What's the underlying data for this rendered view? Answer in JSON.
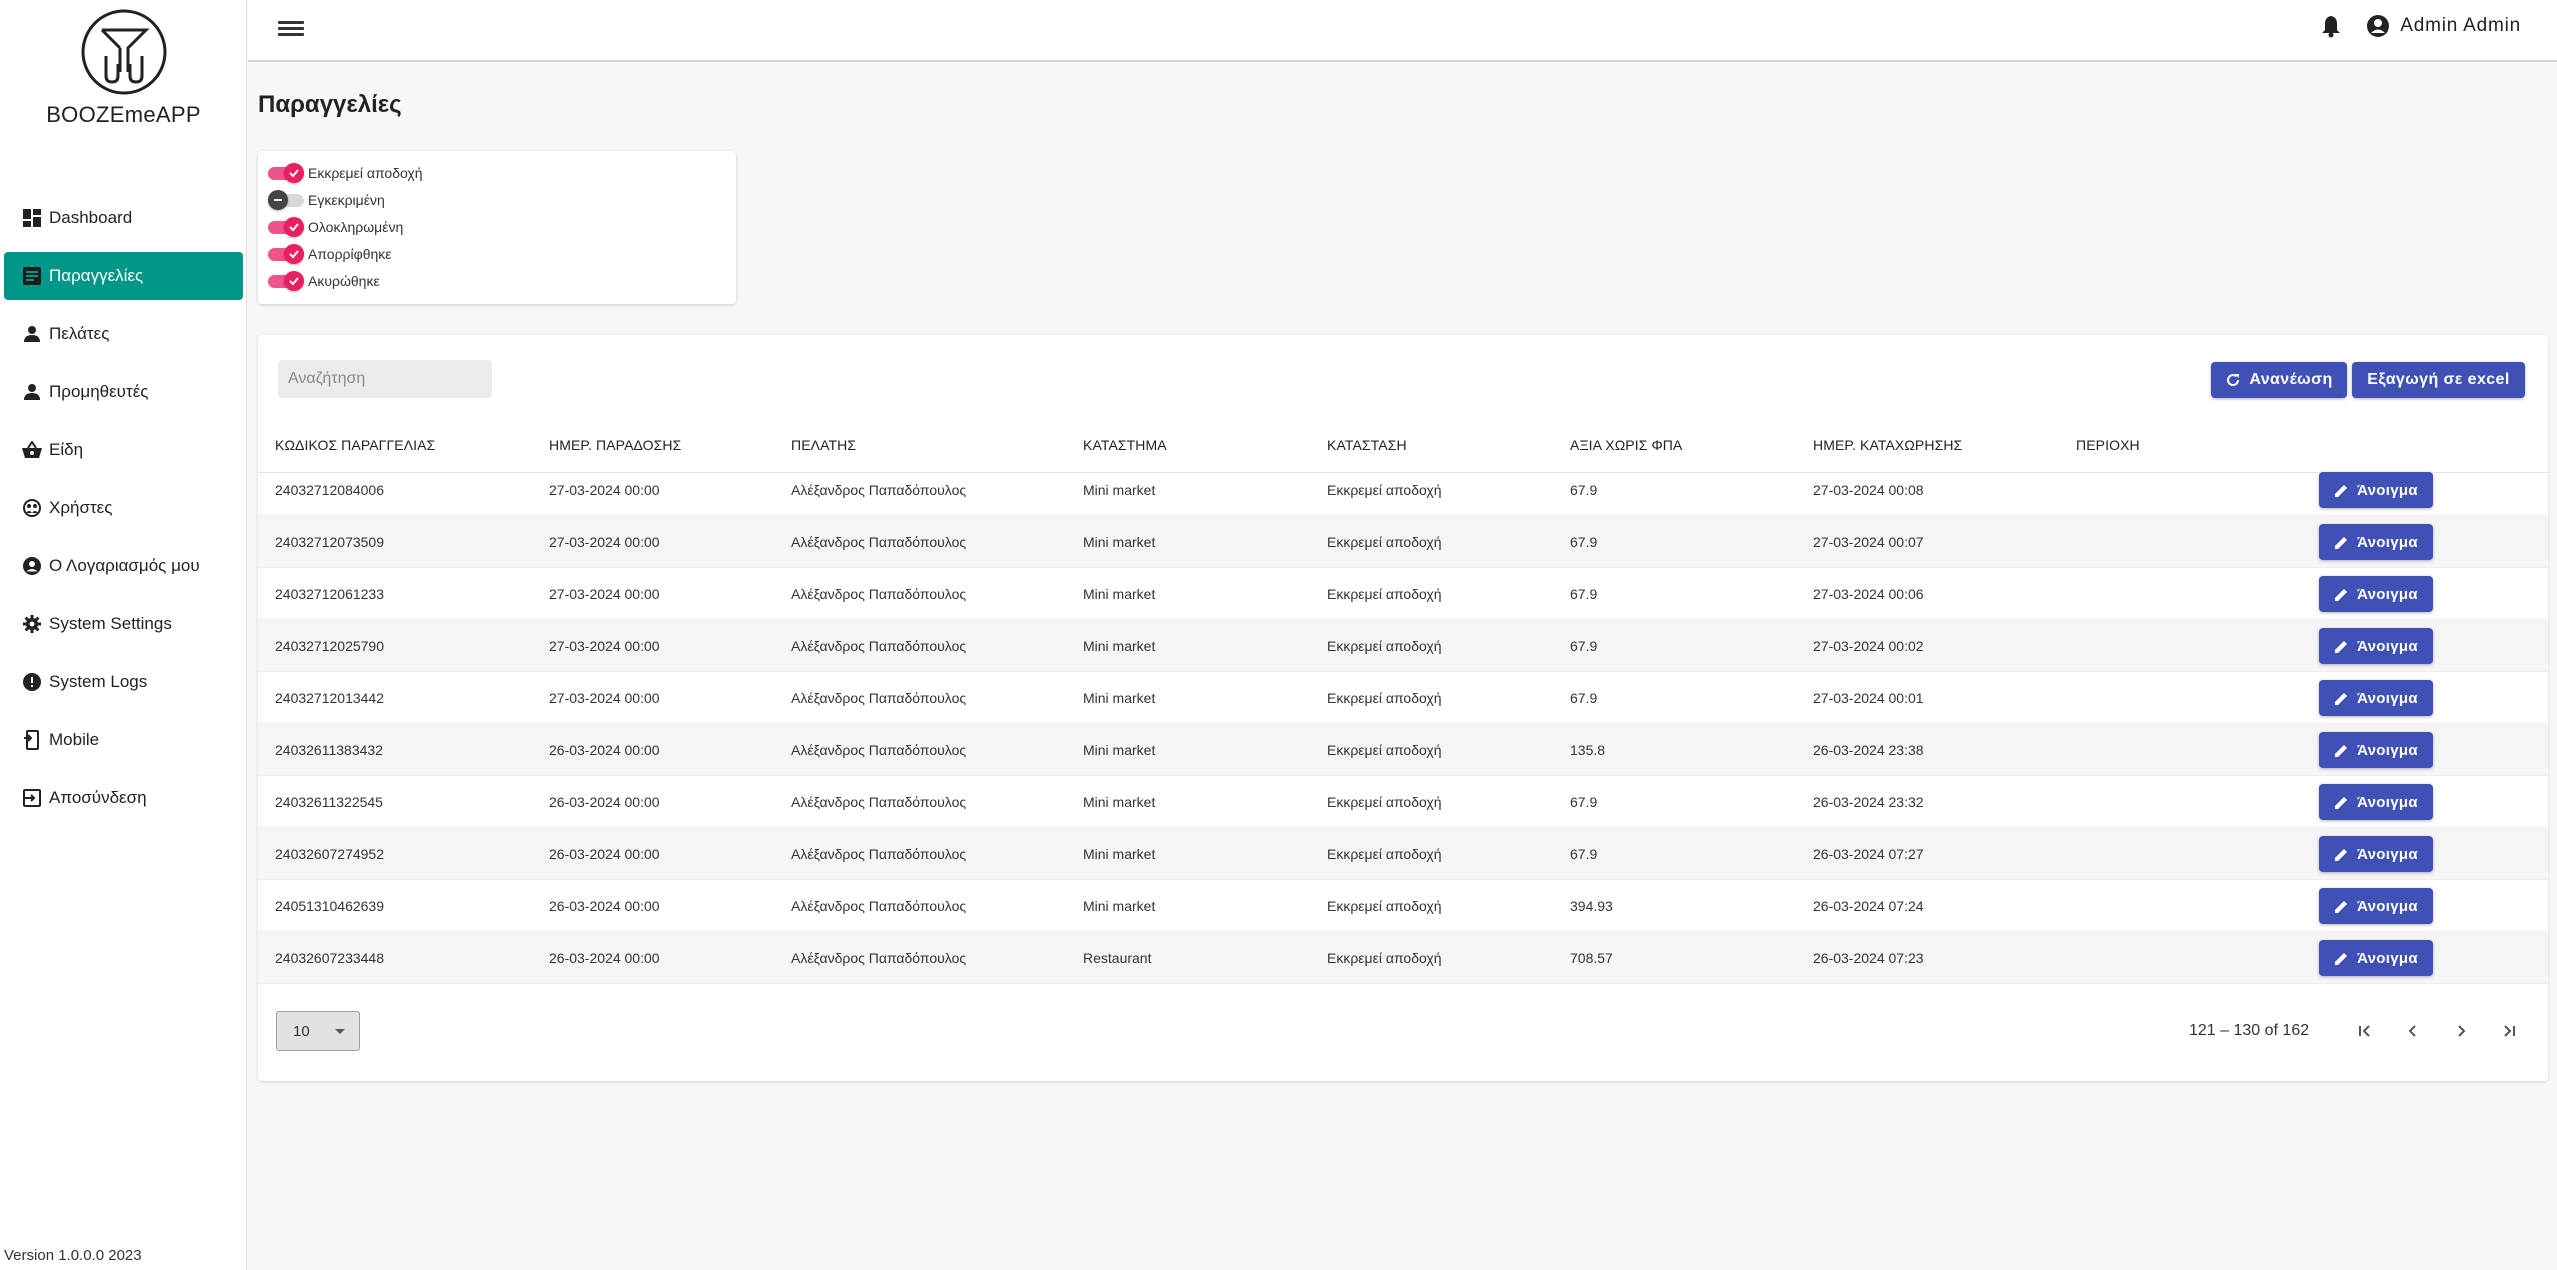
{
  "app": {
    "name": "BOOZEmeAPP",
    "version": "Version 1.0.0.0 2023"
  },
  "sidebar": {
    "items": [
      {
        "label": "Dashboard",
        "icon": "dashboard-icon"
      },
      {
        "label": "Παραγγελίες",
        "icon": "list-icon",
        "active": true
      },
      {
        "label": "Πελάτες",
        "icon": "person-icon"
      },
      {
        "label": "Προμηθευτές",
        "icon": "person-icon"
      },
      {
        "label": "Είδη",
        "icon": "basket-icon"
      },
      {
        "label": "Χρήστες",
        "icon": "users-icon"
      },
      {
        "label": "Ο Λογαριασμός μου",
        "icon": "account-circle-icon"
      },
      {
        "label": "System Settings",
        "icon": "gear-icon"
      },
      {
        "label": "System Logs",
        "icon": "alert-icon"
      },
      {
        "label": "Mobile",
        "icon": "mobile-icon"
      },
      {
        "label": "Αποσύνδεση",
        "icon": "logout-icon"
      }
    ]
  },
  "header": {
    "user_name": "Admin Admin"
  },
  "page": {
    "title": "Παραγγελίες"
  },
  "filters": [
    {
      "label": "Εκκρεμεί αποδοχή",
      "on": true
    },
    {
      "label": "Εγκεκριμένη",
      "on": false
    },
    {
      "label": "Ολοκληρωμένη",
      "on": true
    },
    {
      "label": "Απορρίφθηκε",
      "on": true
    },
    {
      "label": "Ακυρώθηκε",
      "on": true
    }
  ],
  "toolbar": {
    "search_placeholder": "Αναζήτηση",
    "refresh_label": "Ανανέωση",
    "export_label": "Εξαγωγή σε excel"
  },
  "table": {
    "columns": [
      "ΚΩΔΙΚΟΣ ΠΑΡΑΓΓΕΛΙΑΣ",
      "ΗΜΕΡ. ΠΑΡΑΔΟΣΗΣ",
      "ΠΕΛΑΤΗΣ",
      "ΚΑΤΑΣΤΗΜΑ",
      "ΚΑΤΑΣΤΑΣΗ",
      "ΑΞΙΑ ΧΩΡΙΣ ΦΠΑ",
      "ΗΜΕΡ. ΚΑΤΑΧΩΡΗΣΗΣ",
      "ΠΕΡΙΟΧΗ"
    ],
    "open_label": "Άνοιγμα",
    "rows": [
      [
        "24032712084006",
        "27-03-2024 00:00",
        "Αλέξανδρος Παπαδόπουλος",
        "Mini market",
        "Εκκρεμεί αποδοχή",
        "67.9",
        "27-03-2024 00:08",
        ""
      ],
      [
        "24032712073509",
        "27-03-2024 00:00",
        "Αλέξανδρος Παπαδόπουλος",
        "Mini market",
        "Εκκρεμεί αποδοχή",
        "67.9",
        "27-03-2024 00:07",
        ""
      ],
      [
        "24032712061233",
        "27-03-2024 00:00",
        "Αλέξανδρος Παπαδόπουλος",
        "Mini market",
        "Εκκρεμεί αποδοχή",
        "67.9",
        "27-03-2024 00:06",
        ""
      ],
      [
        "24032712025790",
        "27-03-2024 00:00",
        "Αλέξανδρος Παπαδόπουλος",
        "Mini market",
        "Εκκρεμεί αποδοχή",
        "67.9",
        "27-03-2024 00:02",
        ""
      ],
      [
        "24032712013442",
        "27-03-2024 00:00",
        "Αλέξανδρος Παπαδόπουλος",
        "Mini market",
        "Εκκρεμεί αποδοχή",
        "67.9",
        "27-03-2024 00:01",
        ""
      ],
      [
        "24032611383432",
        "26-03-2024 00:00",
        "Αλέξανδρος Παπαδόπουλος",
        "Mini market",
        "Εκκρεμεί αποδοχή",
        "135.8",
        "26-03-2024 23:38",
        ""
      ],
      [
        "24032611322545",
        "26-03-2024 00:00",
        "Αλέξανδρος Παπαδόπουλος",
        "Mini market",
        "Εκκρεμεί αποδοχή",
        "67.9",
        "26-03-2024 23:32",
        ""
      ],
      [
        "24032607274952",
        "26-03-2024 00:00",
        "Αλέξανδρος Παπαδόπουλος",
        "Mini market",
        "Εκκρεμεί αποδοχή",
        "67.9",
        "26-03-2024 07:27",
        ""
      ],
      [
        "24051310462639",
        "26-03-2024 00:00",
        "Αλέξανδρος Παπαδόπουλος",
        "Mini market",
        "Εκκρεμεί αποδοχή",
        "394.93",
        "26-03-2024 07:24",
        ""
      ],
      [
        "24032607233448",
        "26-03-2024 00:00",
        "Αλέξανδρος Παπαδόπουλος",
        "Restaurant",
        "Εκκρεμεί αποδοχή",
        "708.57",
        "26-03-2024 07:23",
        ""
      ]
    ]
  },
  "pagination": {
    "page_size": "10",
    "range": "121 – 130 of 162"
  },
  "colors": {
    "accent": "#009688",
    "primary": "#3f51b5",
    "toggle_on": "#e91e63"
  }
}
